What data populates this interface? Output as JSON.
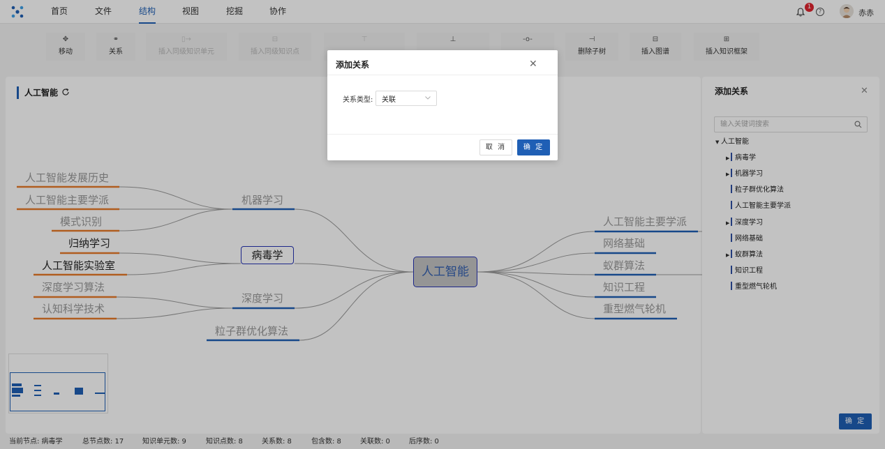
{
  "nav": {
    "items": [
      "首页",
      "文件",
      "结构",
      "视图",
      "挖掘",
      "协作"
    ],
    "active": "结构",
    "notification_count": "1",
    "help_glyph": "?",
    "user_name": "赤赤"
  },
  "toolbar": {
    "items": [
      {
        "label": "移动",
        "icon": "move-icon",
        "enabled": true
      },
      {
        "label": "关系",
        "icon": "relation-icon",
        "enabled": true
      },
      {
        "label": "插入同级知识单元",
        "icon": "insert-sibling-unit-icon",
        "enabled": false
      },
      {
        "label": "插入同级知识点",
        "icon": "insert-sibling-point-icon",
        "enabled": false
      },
      {
        "label": "",
        "icon": "insert-parent-icon",
        "enabled": false
      },
      {
        "label": "",
        "icon": "align-icon",
        "enabled": true
      },
      {
        "label": "",
        "icon": "link-icon",
        "enabled": true
      },
      {
        "label": "删除子树",
        "icon": "delete-subtree-icon",
        "enabled": true
      },
      {
        "label": "插入图谱",
        "icon": "insert-graph-icon",
        "enabled": true
      },
      {
        "label": "插入知识框架",
        "icon": "insert-framework-icon",
        "enabled": true
      }
    ]
  },
  "canvas": {
    "title": "人工智能",
    "root": "人工智能",
    "selected": "病毒学",
    "left_branches": [
      {
        "label": "机器学习",
        "children": [
          "人工智能发展历史",
          "人工智能主要学派",
          "模式识别"
        ]
      },
      {
        "label": "病毒学",
        "children": [
          "归纳学习",
          "人工智能实验室"
        ]
      },
      {
        "label": "深度学习",
        "children": [
          "深度学习算法",
          "认知科学技术"
        ]
      },
      {
        "label": "粒子群优化算法",
        "children": []
      }
    ],
    "right_branches": [
      "人工智能主要学派",
      "网络基础",
      "蚁群算法",
      "知识工程",
      "重型燃气轮机"
    ]
  },
  "right_panel": {
    "title": "添加关系",
    "search_placeholder": "输入关键词搜索",
    "tree_root": "人工智能",
    "tree_items": [
      {
        "label": "病毒学",
        "expandable": true
      },
      {
        "label": "机器学习",
        "expandable": true
      },
      {
        "label": "粒子群优化算法",
        "expandable": false
      },
      {
        "label": "人工智能主要学派",
        "expandable": false
      },
      {
        "label": "深度学习",
        "expandable": true
      },
      {
        "label": "网络基础",
        "expandable": false
      },
      {
        "label": "蚁群算法",
        "expandable": true
      },
      {
        "label": "知识工程",
        "expandable": false
      },
      {
        "label": "重型燃气轮机",
        "expandable": false
      }
    ],
    "ok_label": "确 定"
  },
  "modal": {
    "title": "添加关系",
    "field_label": "关系类型:",
    "relation_type": "关联",
    "cancel_label": "取 消",
    "ok_label": "确 定"
  },
  "status": {
    "current_node": "当前节点: 病毒学",
    "total_nodes": "总节点数: 17",
    "unit_count": "知识单元数: 9",
    "point_count": "知识点数: 8",
    "relation_count": "关系数: 8",
    "contain_count": "包含数: 8",
    "assoc_count": "关联数: 0",
    "seq_count": "后序数: 0"
  },
  "colors": {
    "accent": "#1f5fb5",
    "underline_orange": "#e87b2a",
    "underline_blue": "#1f5fb5",
    "badge_red": "#e0242e"
  }
}
